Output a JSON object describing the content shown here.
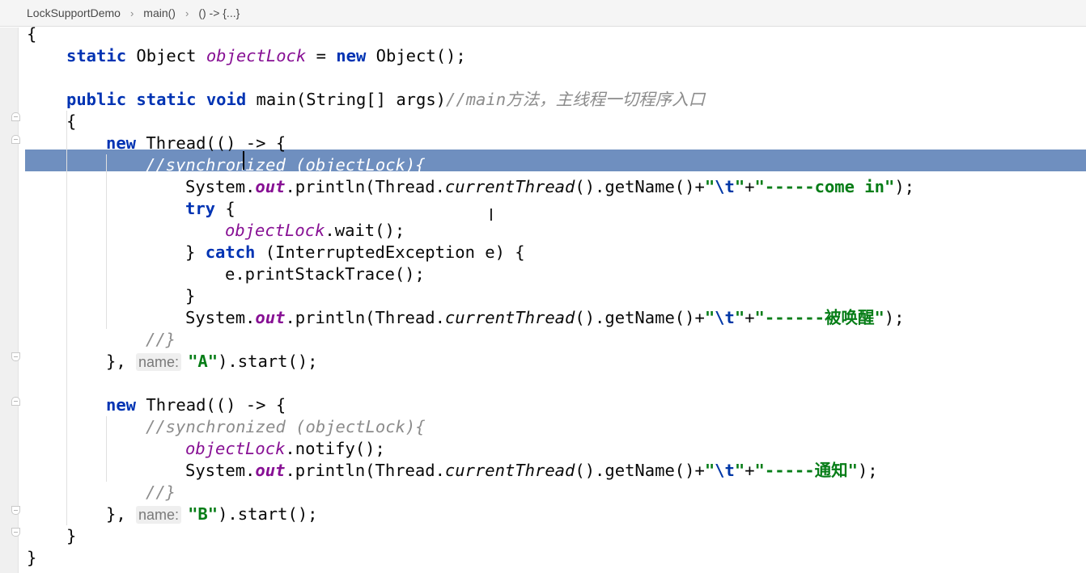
{
  "breadcrumb": {
    "items": [
      "LockSupportDemo",
      "main()",
      "() -> {...}"
    ],
    "separator": "›"
  },
  "editor": {
    "selected_line": 6,
    "lines": [
      {
        "indent": 0,
        "tokens": [
          {
            "t": "{",
            "c": ""
          }
        ]
      },
      {
        "indent": 1,
        "tokens": [
          {
            "t": "static",
            "c": "kw"
          },
          {
            "t": " Object ",
            "c": ""
          },
          {
            "t": "objectLock",
            "c": "fld"
          },
          {
            "t": " = ",
            "c": ""
          },
          {
            "t": "new",
            "c": "kw"
          },
          {
            "t": " Object();",
            "c": ""
          }
        ]
      },
      {
        "indent": 0,
        "tokens": []
      },
      {
        "indent": 1,
        "tokens": [
          {
            "t": "public",
            "c": "kw"
          },
          {
            "t": " ",
            "c": ""
          },
          {
            "t": "static",
            "c": "kw"
          },
          {
            "t": " ",
            "c": ""
          },
          {
            "t": "void",
            "c": "kw"
          },
          {
            "t": " main(String[] args)",
            "c": ""
          },
          {
            "t": "//main方法，主线程一切程序入口",
            "c": "cmt"
          }
        ]
      },
      {
        "indent": 1,
        "tokens": [
          {
            "t": "{",
            "c": ""
          }
        ]
      },
      {
        "indent": 2,
        "tokens": [
          {
            "t": "new",
            "c": "kw"
          },
          {
            "t": " Thread(() -> {",
            "c": ""
          }
        ]
      },
      {
        "indent": 3,
        "tokens": [
          {
            "t": "//synchronized (objectLock){",
            "c": "cmt-sel"
          }
        ]
      },
      {
        "indent": 4,
        "tokens": [
          {
            "t": "System.",
            "c": ""
          },
          {
            "t": "out",
            "c": "static"
          },
          {
            "t": ".println(Thread.",
            "c": ""
          },
          {
            "t": "currentThread",
            "c": "mth"
          },
          {
            "t": "().getName()+",
            "c": ""
          },
          {
            "t": "\"",
            "c": "str"
          },
          {
            "t": "\\t",
            "c": "esc"
          },
          {
            "t": "\"",
            "c": "str"
          },
          {
            "t": "+",
            "c": ""
          },
          {
            "t": "\"-----come in\"",
            "c": "str"
          },
          {
            "t": ");",
            "c": ""
          }
        ]
      },
      {
        "indent": 4,
        "tokens": [
          {
            "t": "try",
            "c": "kw"
          },
          {
            "t": " {",
            "c": ""
          }
        ]
      },
      {
        "indent": 5,
        "tokens": [
          {
            "t": "objectLock",
            "c": "fld"
          },
          {
            "t": ".wait();",
            "c": ""
          }
        ]
      },
      {
        "indent": 4,
        "tokens": [
          {
            "t": "} ",
            "c": ""
          },
          {
            "t": "catch",
            "c": "kw"
          },
          {
            "t": " (InterruptedException e) {",
            "c": ""
          }
        ]
      },
      {
        "indent": 5,
        "tokens": [
          {
            "t": "e.printStackTrace();",
            "c": ""
          }
        ]
      },
      {
        "indent": 4,
        "tokens": [
          {
            "t": "}",
            "c": ""
          }
        ]
      },
      {
        "indent": 4,
        "tokens": [
          {
            "t": "System.",
            "c": ""
          },
          {
            "t": "out",
            "c": "static"
          },
          {
            "t": ".println(Thread.",
            "c": ""
          },
          {
            "t": "currentThread",
            "c": "mth"
          },
          {
            "t": "().getName()+",
            "c": ""
          },
          {
            "t": "\"",
            "c": "str"
          },
          {
            "t": "\\t",
            "c": "esc"
          },
          {
            "t": "\"",
            "c": "str"
          },
          {
            "t": "+",
            "c": ""
          },
          {
            "t": "\"------被唤醒\"",
            "c": "str"
          },
          {
            "t": ");",
            "c": ""
          }
        ]
      },
      {
        "indent": 3,
        "tokens": [
          {
            "t": "//}",
            "c": "cmt"
          }
        ]
      },
      {
        "indent": 2,
        "tokens": [
          {
            "t": "}, ",
            "c": ""
          },
          {
            "t": "name:",
            "c": "hint"
          },
          {
            "t": "\"A\"",
            "c": "str"
          },
          {
            "t": ").start();",
            "c": ""
          }
        ]
      },
      {
        "indent": 0,
        "tokens": []
      },
      {
        "indent": 2,
        "tokens": [
          {
            "t": "new",
            "c": "kw"
          },
          {
            "t": " Thread(() -> {",
            "c": ""
          }
        ]
      },
      {
        "indent": 3,
        "tokens": [
          {
            "t": "//synchronized (objectLock){",
            "c": "cmt"
          }
        ]
      },
      {
        "indent": 4,
        "tokens": [
          {
            "t": "objectLock",
            "c": "fld"
          },
          {
            "t": ".notify();",
            "c": ""
          }
        ]
      },
      {
        "indent": 4,
        "tokens": [
          {
            "t": "System.",
            "c": ""
          },
          {
            "t": "out",
            "c": "static"
          },
          {
            "t": ".println(Thread.",
            "c": ""
          },
          {
            "t": "currentThread",
            "c": "mth"
          },
          {
            "t": "().getName()+",
            "c": ""
          },
          {
            "t": "\"",
            "c": "str"
          },
          {
            "t": "\\t",
            "c": "esc"
          },
          {
            "t": "\"",
            "c": "str"
          },
          {
            "t": "+",
            "c": ""
          },
          {
            "t": "\"-----通知\"",
            "c": "str"
          },
          {
            "t": ");",
            "c": ""
          }
        ]
      },
      {
        "indent": 3,
        "tokens": [
          {
            "t": "//}",
            "c": "cmt"
          }
        ]
      },
      {
        "indent": 2,
        "tokens": [
          {
            "t": "}, ",
            "c": ""
          },
          {
            "t": "name:",
            "c": "hint"
          },
          {
            "t": "\"B\"",
            "c": "str"
          },
          {
            "t": ").start();",
            "c": ""
          }
        ]
      },
      {
        "indent": 1,
        "tokens": [
          {
            "t": "}",
            "c": ""
          }
        ]
      },
      {
        "indent": 0,
        "tokens": [
          {
            "t": "}",
            "c": ""
          }
        ]
      }
    ]
  },
  "colors": {
    "keyword": "#0033b3",
    "field": "#871094",
    "string": "#067d17",
    "comment": "#8c8c8c",
    "selection": "#6f8fbf"
  },
  "icons": [
    "chevron-right-icon",
    "fold-icon",
    "text-cursor-icon"
  ]
}
